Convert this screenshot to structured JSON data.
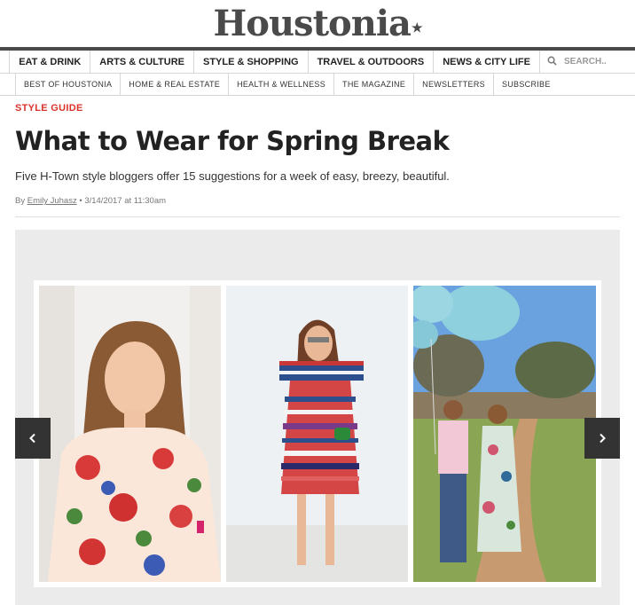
{
  "brand": {
    "logo_text": "Houstonia",
    "logo_mark": "★"
  },
  "nav_primary": [
    {
      "label": "EAT & DRINK"
    },
    {
      "label": "ARTS & CULTURE"
    },
    {
      "label": "STYLE & SHOPPING"
    },
    {
      "label": "TRAVEL & OUTDOORS"
    },
    {
      "label": "NEWS & CITY LIFE"
    }
  ],
  "search": {
    "placeholder": "SEARCH..",
    "icon": "search-icon"
  },
  "nav_secondary": [
    {
      "label": "BEST OF HOUSTONIA"
    },
    {
      "label": "HOME & REAL ESTATE"
    },
    {
      "label": "HEALTH & WELLNESS"
    },
    {
      "label": "THE MAGAZINE"
    },
    {
      "label": "NEWSLETTERS"
    },
    {
      "label": "SUBSCRIBE"
    }
  ],
  "article": {
    "kicker": "STYLE GUIDE",
    "headline": "What to Wear for Spring Break",
    "dek": "Five H-Town style bloggers offer 15 suggestions for a week of easy, breezy, beautiful.",
    "byline_prefix": "By",
    "author": "Emily Juhasz",
    "byline_sep": "•",
    "date": "3/14/2017 at 11:30am"
  },
  "gallery": {
    "prev_icon": "chevron-left-icon",
    "next_icon": "chevron-right-icon"
  },
  "colors": {
    "accent": "#d9332b",
    "nav_bar": "#4a4a4a",
    "gallery_bg": "#ebebeb"
  }
}
